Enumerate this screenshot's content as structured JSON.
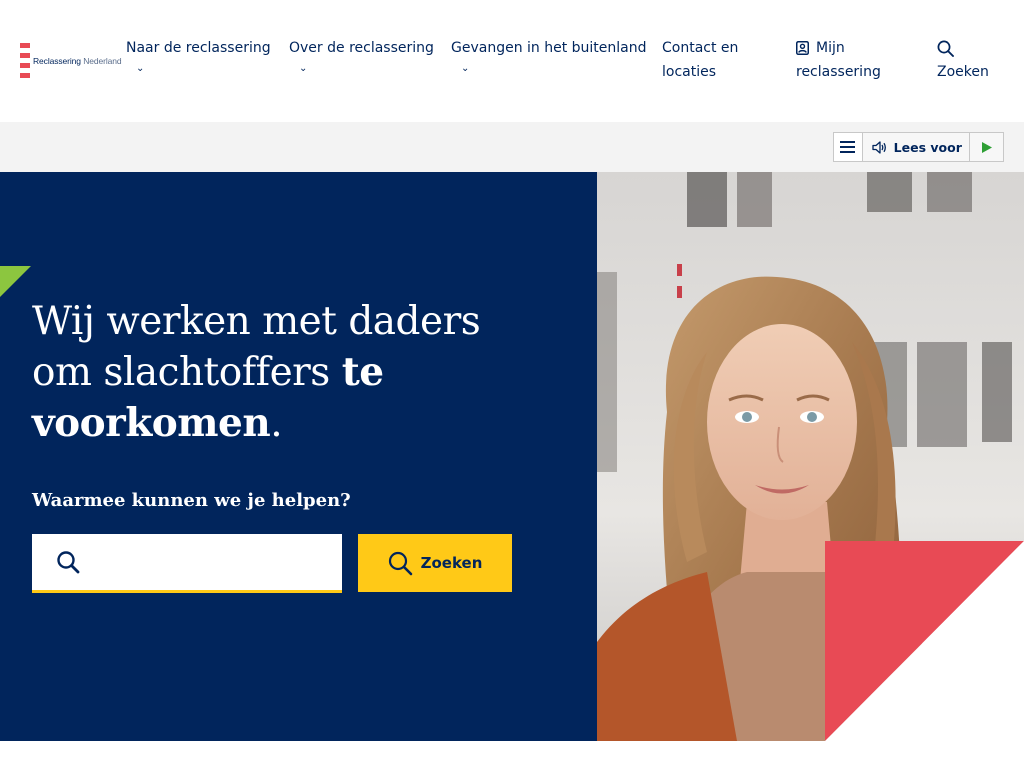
{
  "header": {
    "logo": {
      "brand": "Reclassering",
      "suffix": "Nederland"
    },
    "nav": [
      {
        "label": "Naar de reclassering",
        "has_chevron": true
      },
      {
        "label": "Over de reclassering",
        "has_chevron": true
      },
      {
        "label": "Gevangen in het buitenland",
        "has_chevron": true
      },
      {
        "label_line1": "Contact en",
        "label_line2": "locaties"
      },
      {
        "label_line1": "Mijn",
        "label_line2": "reclassering",
        "icon": "user-badge-icon"
      },
      {
        "label": "Zoeken",
        "icon": "search-icon"
      }
    ]
  },
  "toolbar": {
    "readspeaker": {
      "label": "Lees voor",
      "menu_icon": "menu-icon",
      "speaker_icon": "speaker-icon",
      "play_icon": "play-icon"
    }
  },
  "hero": {
    "title_regular": "Wij werken met daders om slachtoffers ",
    "title_bold": "te voorkomen",
    "title_end": ".",
    "help_label": "Waarmee kunnen we je helpen?",
    "search": {
      "value": "",
      "placeholder": ""
    },
    "search_button": "Zoeken"
  },
  "colors": {
    "navy": "#01255c",
    "yellow": "#ffc917",
    "red": "#e84a55",
    "green": "#8cc63f",
    "strip": "#f3f3f3"
  }
}
